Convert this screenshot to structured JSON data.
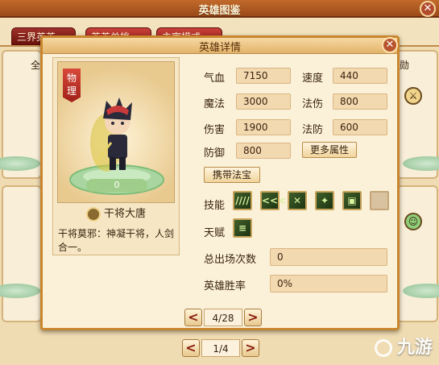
{
  "background_window": {
    "title": "英雄图鉴",
    "tabs": [
      {
        "label": "三界英英"
      },
      {
        "label": "英英单挑"
      },
      {
        "label": "主宰模式"
      }
    ],
    "left_label": "全",
    "right_label": "勋",
    "pager": {
      "prev": "<",
      "label": "1/4",
      "next": ">"
    }
  },
  "detail_dialog": {
    "title": "英雄详情",
    "hero": {
      "type_badge": "物理",
      "level": "0",
      "name": "干将大唐",
      "description": "干将莫邪：神凝干将，人剑合一。"
    },
    "stats": [
      {
        "label": "气血",
        "value": "7150"
      },
      {
        "label": "速度",
        "value": "440"
      },
      {
        "label": "魔法",
        "value": "3000"
      },
      {
        "label": "法伤",
        "value": "800"
      },
      {
        "label": "伤害",
        "value": "1900"
      },
      {
        "label": "法防",
        "value": "600"
      },
      {
        "label": "防御",
        "value": "800"
      }
    ],
    "more_attributes_button": "更多属性",
    "carry_treasure_button": "携带法宝",
    "skills_label": "技能",
    "skill_icons": [
      {
        "name": "claw-skill-icon",
        "glyph": "////"
      },
      {
        "name": "arrows-skill-icon",
        "glyph": "<<<"
      },
      {
        "name": "crossed-swords-skill-icon",
        "glyph": "✕"
      },
      {
        "name": "beast-skill-icon",
        "glyph": "✦"
      },
      {
        "name": "scroll-skill-icon",
        "glyph": "▣"
      },
      {
        "name": "empty-skill-slot-icon",
        "glyph": ""
      }
    ],
    "talent_label": "天赋",
    "talent_icon": {
      "name": "talent-book-icon",
      "glyph": "≡"
    },
    "appearances_label": "总出场次数",
    "appearances_value": "0",
    "win_rate_label": "英雄胜率",
    "win_rate_value": "0%",
    "pager": {
      "prev": "<",
      "label": "4/28",
      "next": ">"
    }
  },
  "watermark": {
    "text": "九游"
  }
}
